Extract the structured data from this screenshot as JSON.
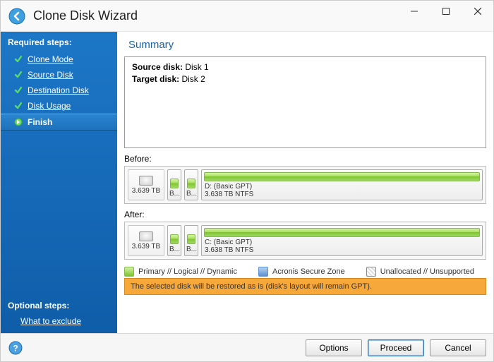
{
  "window": {
    "title": "Clone Disk Wizard"
  },
  "sidebar": {
    "required_label": "Required steps:",
    "steps": [
      {
        "label": "Clone Mode",
        "state": "done"
      },
      {
        "label": "Source Disk",
        "state": "done"
      },
      {
        "label": "Destination Disk",
        "state": "done"
      },
      {
        "label": "Disk Usage",
        "state": "done"
      },
      {
        "label": "Finish",
        "state": "current"
      }
    ],
    "optional_label": "Optional steps:",
    "optional_link": "What to exclude"
  },
  "main": {
    "title": "Summary",
    "summary": {
      "source_label": "Source disk:",
      "source_value": "Disk 1",
      "target_label": "Target disk:",
      "target_value": "Disk 2"
    },
    "before": {
      "label": "Before:",
      "disk_size": "3.639 TB",
      "partitions": [
        {
          "label_top": "B...",
          "label_bottom": ""
        },
        {
          "label_top": "B...",
          "label_bottom": ""
        },
        {
          "label_top": "D: (Basic GPT)",
          "label_bottom": "3.638 TB  NTFS"
        }
      ]
    },
    "after": {
      "label": "After:",
      "disk_size": "3.639 TB",
      "partitions": [
        {
          "label_top": "B...",
          "label_bottom": ""
        },
        {
          "label_top": "B...",
          "label_bottom": ""
        },
        {
          "label_top": "C: (Basic GPT)",
          "label_bottom": "3.638 TB  NTFS"
        }
      ]
    },
    "legend": {
      "primary": "Primary // Logical // Dynamic",
      "secure": "Acronis Secure Zone",
      "unallocated": "Unallocated // Unsupported"
    },
    "notice": "The selected disk will be restored as is (disk's layout will remain GPT)."
  },
  "buttons": {
    "options": "Options",
    "proceed": "Proceed",
    "cancel": "Cancel"
  }
}
